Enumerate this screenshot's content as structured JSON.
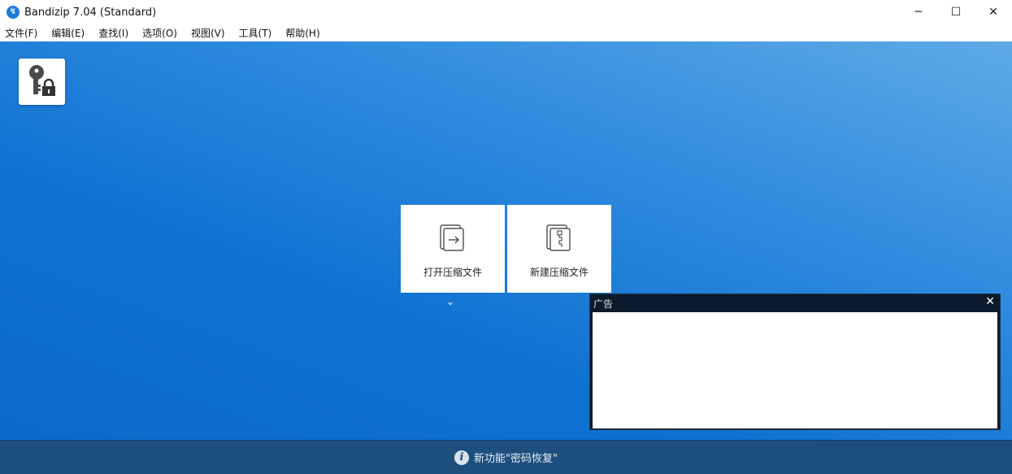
{
  "window": {
    "title": "Bandizip 7.04 (Standard)",
    "minimize": "─",
    "maximize": "☐",
    "close": "✕"
  },
  "menu": [
    "文件(F)",
    "编辑(E)",
    "查找(I)",
    "选项(O)",
    "视图(V)",
    "工具(T)",
    "帮助(H)"
  ],
  "main": {
    "open_archive": "打开压缩文件",
    "new_archive": "新建压缩文件",
    "more": "⌄"
  },
  "ad": {
    "title": "广告",
    "close": "✕"
  },
  "status": {
    "text": "新功能\"密码恢复\""
  }
}
